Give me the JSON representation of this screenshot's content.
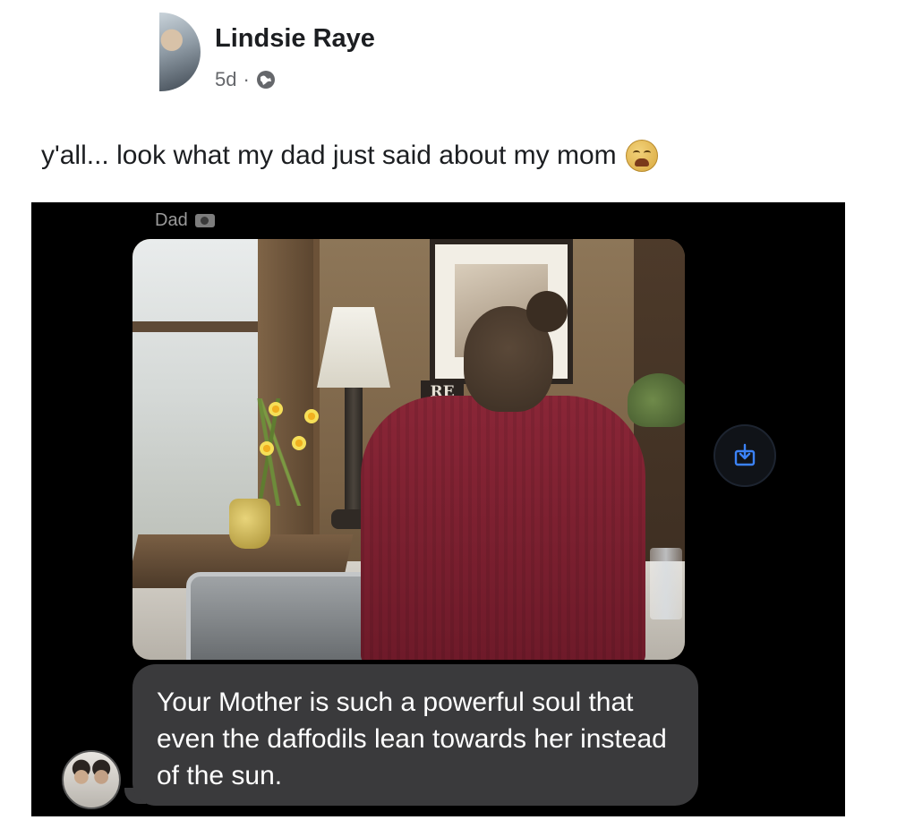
{
  "post": {
    "author": "Lindsie Raye",
    "time": "5d",
    "separator": "·",
    "privacy_icon": "globe-icon",
    "text": "y'all... look what my dad just said about my mom",
    "emoji": "crying-face-icon"
  },
  "thread": {
    "sender": "Dad",
    "photo_icon": "camera-icon",
    "photo_sign": "RE",
    "message": "Your Mother is such a powerful soul that even the daffodils lean towards her instead of the sun.",
    "save_icon": "save-to-device-icon"
  },
  "colors": {
    "panel_bg": "#000000",
    "bubble_bg": "#3a3a3c",
    "save_accent": "#3b82f6"
  }
}
